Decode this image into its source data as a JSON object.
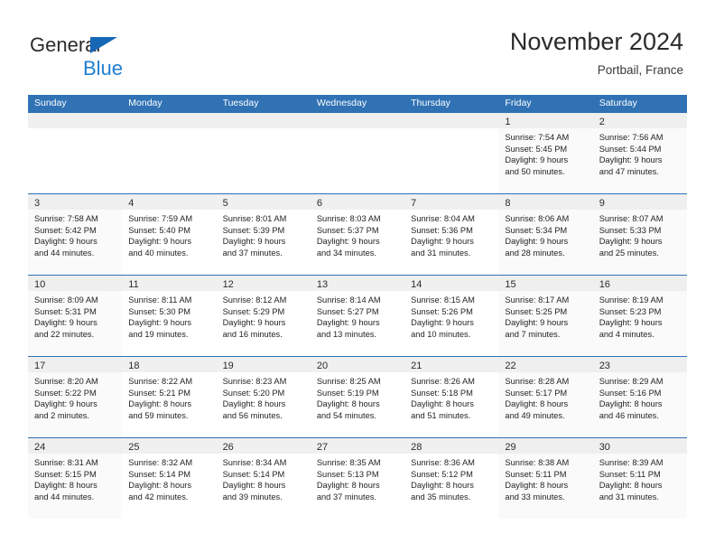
{
  "brand": {
    "name_part1": "General",
    "name_part2": "Blue",
    "triangle_color": "#1667b6",
    "blue_color": "#1f7fd0"
  },
  "header": {
    "title": "November 2024",
    "location": "Portbail, France"
  },
  "theme": {
    "header_blue": "#3072b4",
    "daynum_band": "#f0f0f0",
    "weekend_bg": "#fafafa",
    "text": "#242424"
  },
  "weekdays": [
    "Sunday",
    "Monday",
    "Tuesday",
    "Wednesday",
    "Thursday",
    "Friday",
    "Saturday"
  ],
  "weeks": [
    [
      {
        "day": "",
        "sunrise": "",
        "sunset": "",
        "daylight_1": "",
        "daylight_2": ""
      },
      {
        "day": "",
        "sunrise": "",
        "sunset": "",
        "daylight_1": "",
        "daylight_2": ""
      },
      {
        "day": "",
        "sunrise": "",
        "sunset": "",
        "daylight_1": "",
        "daylight_2": ""
      },
      {
        "day": "",
        "sunrise": "",
        "sunset": "",
        "daylight_1": "",
        "daylight_2": ""
      },
      {
        "day": "",
        "sunrise": "",
        "sunset": "",
        "daylight_1": "",
        "daylight_2": ""
      },
      {
        "day": "1",
        "sunrise": "Sunrise: 7:54 AM",
        "sunset": "Sunset: 5:45 PM",
        "daylight_1": "Daylight: 9 hours",
        "daylight_2": "and 50 minutes."
      },
      {
        "day": "2",
        "sunrise": "Sunrise: 7:56 AM",
        "sunset": "Sunset: 5:44 PM",
        "daylight_1": "Daylight: 9 hours",
        "daylight_2": "and 47 minutes."
      }
    ],
    [
      {
        "day": "3",
        "sunrise": "Sunrise: 7:58 AM",
        "sunset": "Sunset: 5:42 PM",
        "daylight_1": "Daylight: 9 hours",
        "daylight_2": "and 44 minutes."
      },
      {
        "day": "4",
        "sunrise": "Sunrise: 7:59 AM",
        "sunset": "Sunset: 5:40 PM",
        "daylight_1": "Daylight: 9 hours",
        "daylight_2": "and 40 minutes."
      },
      {
        "day": "5",
        "sunrise": "Sunrise: 8:01 AM",
        "sunset": "Sunset: 5:39 PM",
        "daylight_1": "Daylight: 9 hours",
        "daylight_2": "and 37 minutes."
      },
      {
        "day": "6",
        "sunrise": "Sunrise: 8:03 AM",
        "sunset": "Sunset: 5:37 PM",
        "daylight_1": "Daylight: 9 hours",
        "daylight_2": "and 34 minutes."
      },
      {
        "day": "7",
        "sunrise": "Sunrise: 8:04 AM",
        "sunset": "Sunset: 5:36 PM",
        "daylight_1": "Daylight: 9 hours",
        "daylight_2": "and 31 minutes."
      },
      {
        "day": "8",
        "sunrise": "Sunrise: 8:06 AM",
        "sunset": "Sunset: 5:34 PM",
        "daylight_1": "Daylight: 9 hours",
        "daylight_2": "and 28 minutes."
      },
      {
        "day": "9",
        "sunrise": "Sunrise: 8:07 AM",
        "sunset": "Sunset: 5:33 PM",
        "daylight_1": "Daylight: 9 hours",
        "daylight_2": "and 25 minutes."
      }
    ],
    [
      {
        "day": "10",
        "sunrise": "Sunrise: 8:09 AM",
        "sunset": "Sunset: 5:31 PM",
        "daylight_1": "Daylight: 9 hours",
        "daylight_2": "and 22 minutes."
      },
      {
        "day": "11",
        "sunrise": "Sunrise: 8:11 AM",
        "sunset": "Sunset: 5:30 PM",
        "daylight_1": "Daylight: 9 hours",
        "daylight_2": "and 19 minutes."
      },
      {
        "day": "12",
        "sunrise": "Sunrise: 8:12 AM",
        "sunset": "Sunset: 5:29 PM",
        "daylight_1": "Daylight: 9 hours",
        "daylight_2": "and 16 minutes."
      },
      {
        "day": "13",
        "sunrise": "Sunrise: 8:14 AM",
        "sunset": "Sunset: 5:27 PM",
        "daylight_1": "Daylight: 9 hours",
        "daylight_2": "and 13 minutes."
      },
      {
        "day": "14",
        "sunrise": "Sunrise: 8:15 AM",
        "sunset": "Sunset: 5:26 PM",
        "daylight_1": "Daylight: 9 hours",
        "daylight_2": "and 10 minutes."
      },
      {
        "day": "15",
        "sunrise": "Sunrise: 8:17 AM",
        "sunset": "Sunset: 5:25 PM",
        "daylight_1": "Daylight: 9 hours",
        "daylight_2": "and 7 minutes."
      },
      {
        "day": "16",
        "sunrise": "Sunrise: 8:19 AM",
        "sunset": "Sunset: 5:23 PM",
        "daylight_1": "Daylight: 9 hours",
        "daylight_2": "and 4 minutes."
      }
    ],
    [
      {
        "day": "17",
        "sunrise": "Sunrise: 8:20 AM",
        "sunset": "Sunset: 5:22 PM",
        "daylight_1": "Daylight: 9 hours",
        "daylight_2": "and 2 minutes."
      },
      {
        "day": "18",
        "sunrise": "Sunrise: 8:22 AM",
        "sunset": "Sunset: 5:21 PM",
        "daylight_1": "Daylight: 8 hours",
        "daylight_2": "and 59 minutes."
      },
      {
        "day": "19",
        "sunrise": "Sunrise: 8:23 AM",
        "sunset": "Sunset: 5:20 PM",
        "daylight_1": "Daylight: 8 hours",
        "daylight_2": "and 56 minutes."
      },
      {
        "day": "20",
        "sunrise": "Sunrise: 8:25 AM",
        "sunset": "Sunset: 5:19 PM",
        "daylight_1": "Daylight: 8 hours",
        "daylight_2": "and 54 minutes."
      },
      {
        "day": "21",
        "sunrise": "Sunrise: 8:26 AM",
        "sunset": "Sunset: 5:18 PM",
        "daylight_1": "Daylight: 8 hours",
        "daylight_2": "and 51 minutes."
      },
      {
        "day": "22",
        "sunrise": "Sunrise: 8:28 AM",
        "sunset": "Sunset: 5:17 PM",
        "daylight_1": "Daylight: 8 hours",
        "daylight_2": "and 49 minutes."
      },
      {
        "day": "23",
        "sunrise": "Sunrise: 8:29 AM",
        "sunset": "Sunset: 5:16 PM",
        "daylight_1": "Daylight: 8 hours",
        "daylight_2": "and 46 minutes."
      }
    ],
    [
      {
        "day": "24",
        "sunrise": "Sunrise: 8:31 AM",
        "sunset": "Sunset: 5:15 PM",
        "daylight_1": "Daylight: 8 hours",
        "daylight_2": "and 44 minutes."
      },
      {
        "day": "25",
        "sunrise": "Sunrise: 8:32 AM",
        "sunset": "Sunset: 5:14 PM",
        "daylight_1": "Daylight: 8 hours",
        "daylight_2": "and 42 minutes."
      },
      {
        "day": "26",
        "sunrise": "Sunrise: 8:34 AM",
        "sunset": "Sunset: 5:14 PM",
        "daylight_1": "Daylight: 8 hours",
        "daylight_2": "and 39 minutes."
      },
      {
        "day": "27",
        "sunrise": "Sunrise: 8:35 AM",
        "sunset": "Sunset: 5:13 PM",
        "daylight_1": "Daylight: 8 hours",
        "daylight_2": "and 37 minutes."
      },
      {
        "day": "28",
        "sunrise": "Sunrise: 8:36 AM",
        "sunset": "Sunset: 5:12 PM",
        "daylight_1": "Daylight: 8 hours",
        "daylight_2": "and 35 minutes."
      },
      {
        "day": "29",
        "sunrise": "Sunrise: 8:38 AM",
        "sunset": "Sunset: 5:11 PM",
        "daylight_1": "Daylight: 8 hours",
        "daylight_2": "and 33 minutes."
      },
      {
        "day": "30",
        "sunrise": "Sunrise: 8:39 AM",
        "sunset": "Sunset: 5:11 PM",
        "daylight_1": "Daylight: 8 hours",
        "daylight_2": "and 31 minutes."
      }
    ]
  ]
}
